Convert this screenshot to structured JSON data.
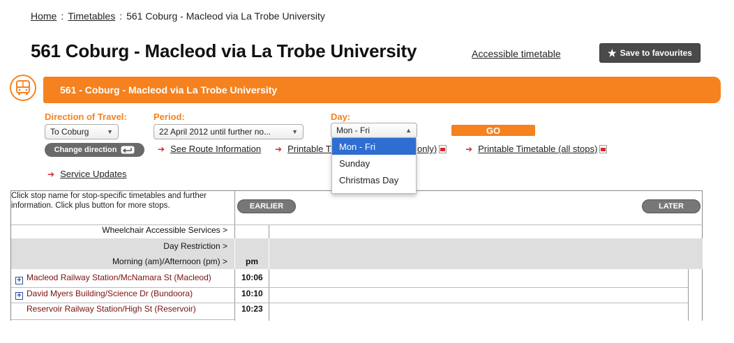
{
  "breadcrumb": {
    "items": [
      "Home",
      "Timetables",
      "561 Coburg - Macleod via La Trobe University"
    ],
    "separator": ":"
  },
  "header": {
    "title": "561 Coburg - Macleod via La Trobe University",
    "accessible_link": "Accessible timetable",
    "favourite_button": "Save to favourites",
    "favourite_icon": "star-icon"
  },
  "banner": {
    "icon": "bus-icon",
    "text": "561 - Coburg - Macleod via La Trobe University",
    "color": "#f5821f"
  },
  "form": {
    "direction_label": "Direction of Travel:",
    "direction_value": "To Coburg",
    "period_label": "Period:",
    "period_value": "22 April 2012 until further no...",
    "day_label": "Day:",
    "day_value": "Mon - Fri",
    "go_label": "GO",
    "change_direction_label": "Change direction",
    "day_options": [
      "Mon - Fri",
      "Sunday",
      "Christmas Day"
    ]
  },
  "links": {
    "route_info": "See Route Information",
    "printable_partial_prefix": "Printable Ti",
    "printable_partial_suffix": "only)",
    "printable_all": "Printable Timetable (all stops)",
    "service_updates": "Service Updates"
  },
  "timetable": {
    "info": "Click stop name for stop-specific timetables and further information. Click plus button for more stops.",
    "earlier_label": "EARLIER",
    "later_label": "LATER",
    "wheelchair_label": "Wheelchair Accessible Services >",
    "day_restriction_label": "Day Restriction >",
    "ampm_label": "Morning (am)/Afternoon (pm) >",
    "ampm_value": "pm",
    "stops": [
      {
        "name": "Macleod Railway Station/McNamara St (Macleod)",
        "time": "10:06",
        "expandable": true
      },
      {
        "name": "David Myers Building/Science Dr (Bundoora)",
        "time": "10:10",
        "expandable": true
      },
      {
        "name": "Reservoir Railway Station/High St (Reservoir)",
        "time": "10:23",
        "expandable": false
      }
    ]
  }
}
